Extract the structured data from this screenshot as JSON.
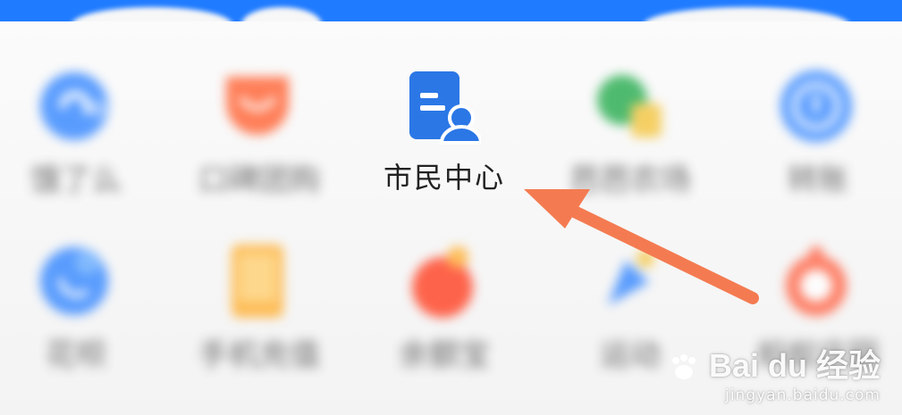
{
  "colors": {
    "topbar": "#1f7bff",
    "arrow": "#f47b51",
    "center_icon": "#2b77e6"
  },
  "row1": [
    {
      "label": "饿了么",
      "icon": "eleme-icon",
      "color": "#3d8cff"
    },
    {
      "label": "口碑团购",
      "icon": "koubei-icon",
      "color": "#ff6a3d"
    },
    {
      "label": "市民中心",
      "icon": "citizen-center-icon",
      "color": "#2b77e6"
    },
    {
      "label": "芭芭农场",
      "icon": "farm-icon",
      "color": "#31b057"
    },
    {
      "label": "转账",
      "icon": "transfer-icon",
      "color": "#3d8cff"
    }
  ],
  "row2": [
    {
      "label": "花呗",
      "icon": "huabei-icon",
      "color": "#3d8cff"
    },
    {
      "label": "手机充值",
      "icon": "phone-recharge-icon",
      "color": "#ffb33d"
    },
    {
      "label": "余额宝",
      "icon": "yuebao-icon",
      "color": "#ff4a2d"
    },
    {
      "label": "运动",
      "icon": "sport-icon",
      "color": "#3d8cff"
    },
    {
      "label": "蚂蚁庄园",
      "icon": "manor-icon",
      "color": "#ff6a4d"
    }
  ],
  "watermark": {
    "brand": "Bai du 经验",
    "url": "jingyan.baidu.com"
  }
}
